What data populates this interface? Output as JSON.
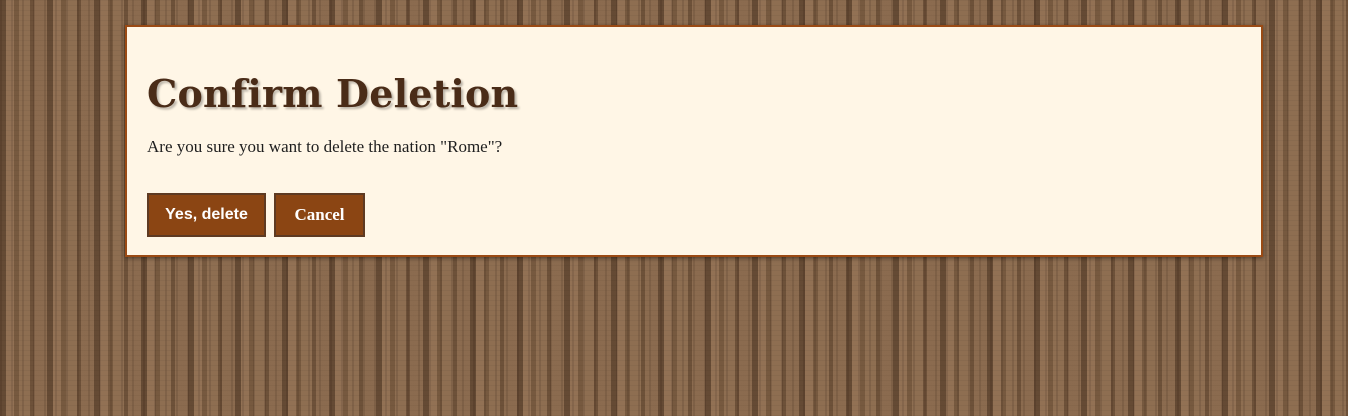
{
  "dialog": {
    "title": "Confirm Deletion",
    "message": "Are you sure you want to delete the nation \"Rome\"?",
    "confirm_label": "Yes, delete",
    "cancel_label": "Cancel"
  },
  "colors": {
    "dialog_background": "#fff6e6",
    "dialog_border": "#9a4a14",
    "title_text": "#4a2c18",
    "button_background": "#8b4513",
    "button_text": "#ffffff",
    "page_background": "#8a6a4e"
  }
}
